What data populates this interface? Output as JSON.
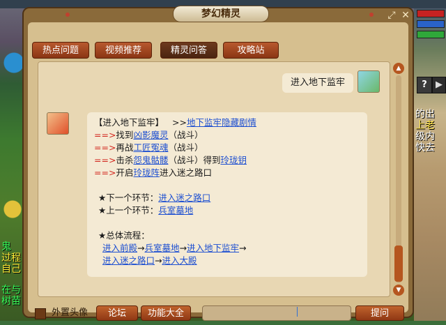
{
  "window": {
    "title": "梦幻精灵"
  },
  "tabs": [
    {
      "label": "热点问题"
    },
    {
      "label": "视频推荐"
    },
    {
      "label": "精灵问答"
    },
    {
      "label": "攻略站"
    }
  ],
  "user_message": "进入地下监牢",
  "npc_reply": {
    "heading": "【进入地下监牢】",
    "heading_arrow": ">>",
    "heading_link": "地下监牢隐藏剧情",
    "step_marker": "==>",
    "steps": [
      {
        "pre": "找到",
        "link": "凶影魔灵",
        "post": "（战斗）"
      },
      {
        "pre": "再战",
        "link": "工匠冤魂",
        "post": "（战斗）"
      },
      {
        "pre": "击杀",
        "link": "怨鬼骷髅",
        "post": "（战斗）得到",
        "link2": "玲珑钥"
      },
      {
        "pre": "开启",
        "link": "玲珑阵",
        "post": "进入迷之路口"
      }
    ],
    "next_label": "★下一个环节：",
    "next_link": "进入迷之路口",
    "prev_label": "★上一个环节：",
    "prev_link": "兵室墓地",
    "flow_label": "★总体流程：",
    "flow_row1": [
      "进入前殿",
      "兵室墓地",
      "进入地下监牢"
    ],
    "flow_row2": [
      "进入迷之路口",
      "进入大殿"
    ],
    "flow_arrow": "→"
  },
  "bottom": {
    "checkbox_label": "外置头像",
    "forum_button": "论坛",
    "features_button": "功能大全",
    "ask_button": "提问",
    "input_value": ""
  },
  "side_text": {
    "line1": "的出",
    "line2": "上老",
    "line3": "级内",
    "line4": "快去"
  },
  "left_text": {
    "l1": "鬼",
    "l2": "过程",
    "l3": "自己",
    "l4": "在与",
    "l5": "树苗"
  },
  "colors": {
    "link": "#1d4fd1",
    "marker": "#d2241c",
    "tab": "#a4471f",
    "panel": "#d6bf8f"
  }
}
